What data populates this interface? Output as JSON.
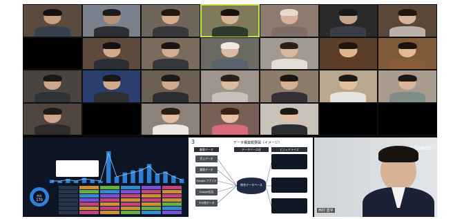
{
  "window": {
    "title": ""
  },
  "tiles": [
    {
      "row": 0,
      "col": 0,
      "bg": "#5a4b3e",
      "skin": "#c79f7e",
      "hair": "#141110",
      "shirt": "#36404a",
      "name": ""
    },
    {
      "row": 0,
      "col": 1,
      "bg": "#7b818c",
      "skin": "#b89278",
      "hair": "#1d1a17",
      "shirt": "#2e2e34",
      "name": ""
    },
    {
      "row": 0,
      "col": 2,
      "bg": "#6e655b",
      "skin": "#d6ad8c",
      "hair": "#20170f",
      "shirt": "#37363b",
      "name": ""
    },
    {
      "row": 0,
      "col": 3,
      "bg": "#7f7a5a",
      "skin": "#d7b596",
      "hair": "#19130f",
      "shirt": "#2f3a2f",
      "name": "",
      "active": true
    },
    {
      "row": 0,
      "col": 4,
      "bg": "#8d7b6f",
      "skin": "#d6b197",
      "hair": "#e8d9cf",
      "shirt": "#7e6e66",
      "name": ""
    },
    {
      "row": 0,
      "col": 5,
      "bg": "#2a2a2a",
      "skin": "#c6a489",
      "hair": "#1b1714",
      "shirt": "#3b3e42",
      "name": ""
    },
    {
      "row": 0,
      "col": 6,
      "bg": "#5a4738",
      "skin": "#d8b59a",
      "hair": "#22180f",
      "shirt": "#b9b1aa",
      "name": ""
    },
    {
      "row": 1,
      "col": 0,
      "bg": "#000000",
      "skin": "#000000",
      "hair": "#000000",
      "shirt": "#000000",
      "name": "",
      "empty": true
    },
    {
      "row": 1,
      "col": 1,
      "bg": "#5d4a3d",
      "skin": "#d3aa8c",
      "hair": "#151210",
      "shirt": "#2a2f35",
      "name": ""
    },
    {
      "row": 1,
      "col": 2,
      "bg": "#796b5d",
      "skin": "#d4ad8f",
      "hair": "#1a1511",
      "shirt": "#34383c",
      "name": ""
    },
    {
      "row": 1,
      "col": 3,
      "bg": "#6b6b63",
      "skin": "#d9bca1",
      "hair": "#efe8e2",
      "shirt": "#58636c",
      "name": ""
    },
    {
      "row": 1,
      "col": 4,
      "bg": "#a09a91",
      "skin": "#d9b89c",
      "hair": "#2a1e16",
      "shirt": "#e4ddd5",
      "name": ""
    },
    {
      "row": 1,
      "col": 5,
      "bg": "#5a3e2a",
      "skin": "#e0b58e",
      "hair": "#1d140d",
      "shirt": "#5d3b24",
      "name": ""
    },
    {
      "row": 1,
      "col": 6,
      "bg": "#7f5b3a",
      "skin": "#e2b992",
      "hair": "#1b130c",
      "shirt": "#8a5d36",
      "name": ""
    },
    {
      "row": 2,
      "col": 0,
      "bg": "#4a4440",
      "skin": "#cfa88b",
      "hair": "#1a1715",
      "shirt": "#2f3338",
      "name": ""
    },
    {
      "row": 2,
      "col": 1,
      "bg": "#2a3f6d",
      "skin": "#d1a98b",
      "hair": "#1b1714",
      "shirt": "#2d2f33",
      "name": ""
    },
    {
      "row": 2,
      "col": 2,
      "bg": "#6c5f54",
      "skin": "#cfa98b",
      "hair": "#1c1815",
      "shirt": "#2b2e33",
      "name": ""
    },
    {
      "row": 2,
      "col": 3,
      "bg": "#9d958c",
      "skin": "#dcbca0",
      "hair": "#2a2017",
      "shirt": "#c9c1b9",
      "name": ""
    },
    {
      "row": 2,
      "col": 4,
      "bg": "#8b7b6b",
      "skin": "#d7b093",
      "hair": "#1a1510",
      "shirt": "#343036",
      "name": ""
    },
    {
      "row": 2,
      "col": 5,
      "bg": "#b9a88e",
      "skin": "#e2bf9e",
      "hair": "#1e1812",
      "shirt": "#e7e3de",
      "name": ""
    },
    {
      "row": 2,
      "col": 6,
      "bg": "#a89c8e",
      "skin": "#d8b59b",
      "hair": "#1c1815",
      "shirt": "#7f8d86",
      "name": ""
    },
    {
      "row": 3,
      "col": 0,
      "bg": "#51463f",
      "skin": "#cfa68a",
      "hair": "#1d1915",
      "shirt": "#2f2c2b",
      "name": ""
    },
    {
      "row": 3,
      "col": 1,
      "bg": "#000000",
      "skin": "#000000",
      "hair": "#000000",
      "shirt": "#000000",
      "name": "",
      "empty": true
    },
    {
      "row": 3,
      "col": 2,
      "bg": "#8c8279",
      "skin": "#e0bca0",
      "hair": "#2a1f17",
      "shirt": "#ece7e1",
      "name": ""
    },
    {
      "row": 3,
      "col": 3,
      "bg": "#7a5f57",
      "skin": "#e7c2a7",
      "hair": "#3a2218",
      "shirt": "#d96a7d",
      "name": ""
    },
    {
      "row": 3,
      "col": 4,
      "bg": "#c9c2b9",
      "skin": "#e2bfa3",
      "hair": "#1e1813",
      "shirt": "#2c2d30",
      "name": ""
    },
    {
      "row": 3,
      "col": 5,
      "bg": "#000000",
      "skin": "#000000",
      "hair": "#000000",
      "shirt": "#000000",
      "name": "",
      "empty": true
    },
    {
      "row": 3,
      "col": 6,
      "bg": "#000000",
      "skin": "#000000",
      "hair": "#000000",
      "shirt": "#000000",
      "name": "",
      "empty": true
    }
  ],
  "dashboard": {
    "title": "",
    "kpi_label": "合計",
    "kpi_value": "170",
    "tooltip_lines": [
      "",
      "",
      ""
    ],
    "bars": [
      3,
      2,
      4,
      2,
      5,
      3,
      2,
      30,
      6,
      10,
      12,
      14,
      18,
      9,
      11,
      7,
      4
    ],
    "line": [
      2,
      2,
      3,
      2,
      4,
      3,
      2,
      28,
      6,
      8,
      10,
      12,
      16,
      8,
      10,
      6,
      3
    ],
    "table_colors": [
      "#e24c8b",
      "#f0a43a",
      "#7ac943",
      "#3aa0e8",
      "#8b5cf6",
      "#e24c8b",
      "#f0a43a"
    ]
  },
  "slide": {
    "number": "3",
    "title": "データ構築概要図（イメージ）",
    "col_left": "顧客データ",
    "col_mid": "データベース化",
    "col_right": "ビジュアライズ",
    "sources": [
      "売上データ",
      "顧客データ",
      "Google アナリティクス",
      "Google広告",
      "その他データ"
    ],
    "database_label": "統合データベース"
  },
  "speaker": {
    "logo": "Funai Soken",
    "name": "西村 直平"
  }
}
